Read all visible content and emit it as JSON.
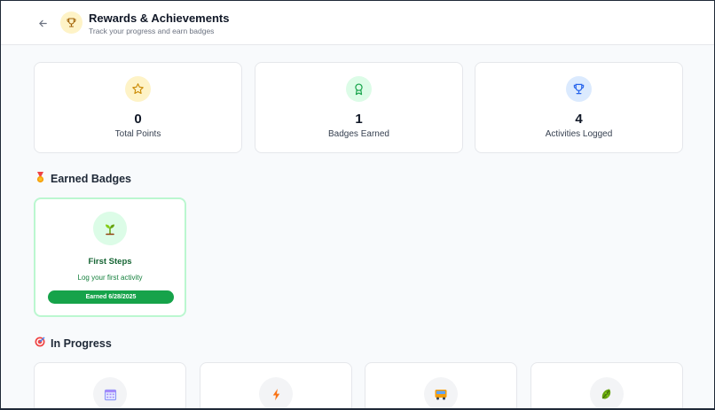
{
  "header": {
    "title": "Rewards & Achievements",
    "subtitle": "Track your progress and earn badges",
    "back_icon": "arrow-left-icon",
    "title_icon": "trophy-icon"
  },
  "stats": [
    {
      "value": "0",
      "label": "Total Points",
      "icon": "star-icon",
      "icon_bg": "#fef3c7",
      "icon_color": "#ca8a04"
    },
    {
      "value": "1",
      "label": "Badges Earned",
      "icon": "award-icon",
      "icon_bg": "#dcfce7",
      "icon_color": "#16a34a"
    },
    {
      "value": "4",
      "label": "Activities Logged",
      "icon": "trophy-icon",
      "icon_bg": "#dbeafe",
      "icon_color": "#2563eb"
    }
  ],
  "earned_section": {
    "title": "Earned Badges",
    "icon": "medal-emoji-icon"
  },
  "earned_badges": [
    {
      "name": "First Steps",
      "description": "Log your first activity",
      "earned_label": "Earned 6/28/2025",
      "icon": "seedling-emoji-icon"
    }
  ],
  "in_progress_section": {
    "title": "In Progress",
    "icon": "target-emoji-icon"
  },
  "in_progress_badges": [
    {
      "icon": "calendar-emoji-icon"
    },
    {
      "icon": "lightning-emoji-icon"
    },
    {
      "icon": "bus-emoji-icon"
    },
    {
      "icon": "leafy-green-emoji-icon"
    }
  ],
  "colors": {
    "accent_green": "#16a34a",
    "badge_border": "#bbf7d0",
    "page_bg": "#f8fafc"
  }
}
